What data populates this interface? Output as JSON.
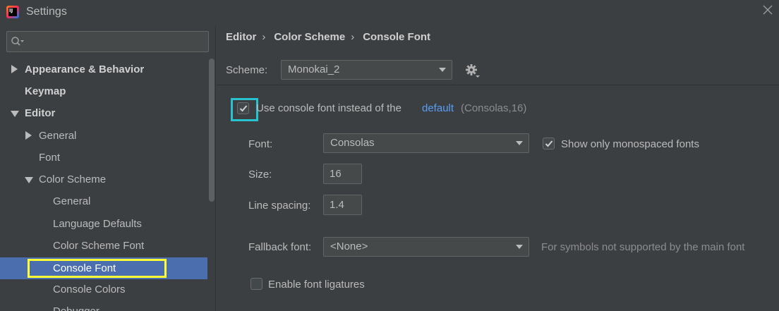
{
  "window": {
    "title": "Settings",
    "logo_text": "IJ"
  },
  "search": {
    "placeholder": "",
    "value": ""
  },
  "sidebar": {
    "items": [
      {
        "label": "Appearance & Behavior"
      },
      {
        "label": "Keymap"
      },
      {
        "label": "Editor"
      },
      {
        "label": "General"
      },
      {
        "label": "Font"
      },
      {
        "label": "Color Scheme"
      },
      {
        "label": "General"
      },
      {
        "label": "Language Defaults"
      },
      {
        "label": "Color Scheme Font"
      },
      {
        "label": "Console Font"
      },
      {
        "label": "Console Colors"
      },
      {
        "label": "Debugger"
      }
    ]
  },
  "breadcrumb": {
    "items": [
      "Editor",
      "Color Scheme",
      "Console Font"
    ],
    "separator": "›"
  },
  "scheme": {
    "label": "Scheme:",
    "value": "Monokai_2"
  },
  "console_font": {
    "use_label": "Use console font instead of the",
    "use_checked": true,
    "default_link": "default",
    "default_detail": "(Consolas,16)"
  },
  "font": {
    "label": "Font:",
    "value": "Consolas",
    "mono_label": "Show only monospaced fonts",
    "mono_checked": true
  },
  "size": {
    "label": "Size:",
    "value": "16"
  },
  "line_spacing": {
    "label": "Line spacing:",
    "value": "1.4"
  },
  "fallback": {
    "label": "Fallback font:",
    "value": "<None>",
    "hint": "For symbols not supported by the main font"
  },
  "ligatures": {
    "label": "Enable font ligatures",
    "checked": false
  },
  "colors": {
    "background": "#3c3f41",
    "selection": "#4b6eaf",
    "link": "#589df6",
    "highlight_yellow": "#ffff33",
    "highlight_cyan": "#29c3cf"
  }
}
